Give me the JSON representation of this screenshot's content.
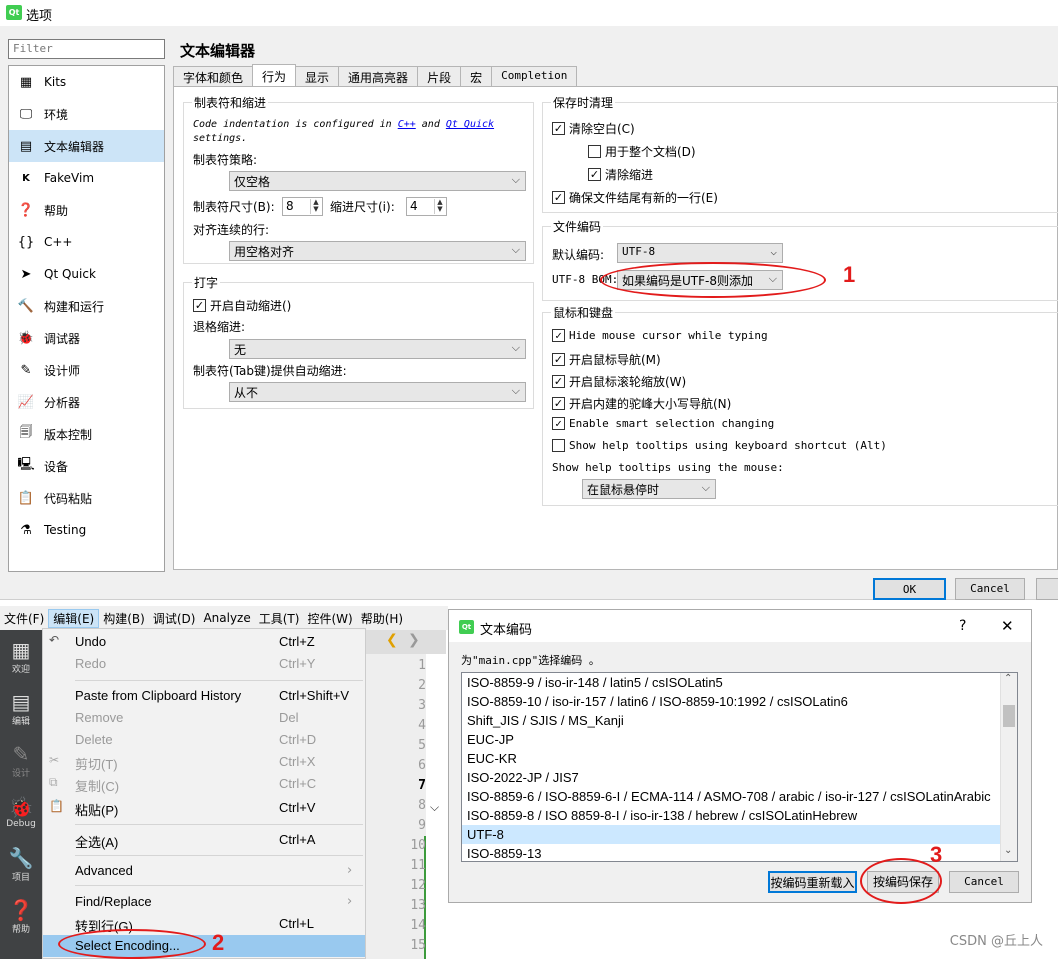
{
  "top": {
    "title": "选项",
    "filter_placeholder": "Filter",
    "sidebar": [
      "Kits",
      "环境",
      "文本编辑器",
      "FakeVim",
      "帮助",
      "C++",
      "Qt Quick",
      "构建和运行",
      "调试器",
      "设计师",
      "分析器",
      "版本控制",
      "设备",
      "代码粘贴",
      "Testing"
    ],
    "page_title": "文本编辑器",
    "tabs": [
      "字体和颜色",
      "行为",
      "显示",
      "通用高亮器",
      "片段",
      "宏",
      "Completion"
    ],
    "tabs_indent": {
      "title": "制表符和缩进",
      "note_a": "Code indentation is configured in ",
      "link_cpp": "C++",
      "note_and": " and ",
      "link_qtquick": "Qt Quick",
      "note_b": "settings.",
      "policy_label": "制表符策略:",
      "policy_value": "仅空格",
      "tab_size_label": "制表符尺寸(B):",
      "tab_size": "8",
      "indent_size_label": "缩进尺寸(i):",
      "indent_size": "4",
      "align_label": "对齐连续的行:",
      "align_value": "用空格对齐"
    },
    "typing": {
      "title": "打字",
      "auto_indent": "开启自动缩进()",
      "backspace_label": "退格缩进:",
      "backspace_value": "无",
      "tab_key_label": "制表符(Tab键)提供自动缩进:",
      "tab_key_value": "从不"
    },
    "cleanup": {
      "title": "保存时清理",
      "clean_whitespace": "清除空白(C)",
      "entire_doc": "用于整个文档(D)",
      "clean_indent": "清除缩进",
      "ensure_newline": "确保文件结尾有新的一行(E)"
    },
    "encoding": {
      "title": "文件编码",
      "default_label": "默认编码:",
      "default_value": "UTF-8",
      "bom_label": "UTF-8 BOM:",
      "bom_value": "如果编码是UTF-8则添加"
    },
    "mouse": {
      "title": "鼠标和键盘",
      "items": [
        "Hide mouse cursor while typing",
        "开启鼠标导航(M)",
        "开启鼠标滚轮缩放(W)",
        "开启内建的驼峰大小写导航(N)",
        "Enable smart selection changing",
        "Show help tooltips using keyboard shortcut (Alt)"
      ],
      "checked": [
        true,
        true,
        true,
        true,
        true,
        false
      ],
      "tooltip_label": "Show help tooltips using the mouse:",
      "tooltip_value": "在鼠标悬停时"
    },
    "ok": "OK",
    "cancel": "Cancel"
  },
  "annotations": [
    "1",
    "2",
    "3"
  ],
  "menubar": [
    "文件(F)",
    "编辑(E)",
    "构建(B)",
    "调试(D)",
    "Analyze",
    "工具(T)",
    "控件(W)",
    "帮助(H)"
  ],
  "leftbar": [
    "欢迎",
    "编辑",
    "设计",
    "Debug",
    "项目",
    "帮助"
  ],
  "edit_menu": [
    {
      "label": "Undo",
      "shortcut": "Ctrl+Z",
      "disabled": false
    },
    {
      "label": "Redo",
      "shortcut": "Ctrl+Y",
      "disabled": true
    },
    {
      "label": "Paste from Clipboard History",
      "shortcut": "Ctrl+Shift+V",
      "disabled": false
    },
    {
      "label": "Remove",
      "shortcut": "Del",
      "disabled": true
    },
    {
      "label": "Delete",
      "shortcut": "Ctrl+D",
      "disabled": true
    },
    {
      "label": "剪切(T)",
      "shortcut": "Ctrl+X",
      "disabled": true
    },
    {
      "label": "复制(C)",
      "shortcut": "Ctrl+C",
      "disabled": true
    },
    {
      "label": "粘贴(P)",
      "shortcut": "Ctrl+V",
      "disabled": false
    },
    {
      "label": "全选(A)",
      "shortcut": "Ctrl+A",
      "disabled": false
    },
    {
      "label": "Advanced",
      "shortcut": "",
      "disabled": false
    },
    {
      "label": "Find/Replace",
      "shortcut": "",
      "disabled": false
    },
    {
      "label": "转到行(G)...",
      "shortcut": "Ctrl+L",
      "disabled": false
    },
    {
      "label": "Select Encoding...",
      "shortcut": "",
      "disabled": false
    }
  ],
  "gutter": [
    "1",
    "2",
    "3",
    "4",
    "5",
    "6",
    "7",
    "8",
    "9",
    "10",
    "11",
    "12",
    "13",
    "14",
    "15"
  ],
  "enc_dialog": {
    "title": "文本编码",
    "help": "?",
    "close": "✕",
    "prompt": "为\"main.cpp\"选择编码 。",
    "items": [
      "ISO-8859-9 / iso-ir-148 / latin5 / csISOLatin5",
      "ISO-8859-10 / iso-ir-157 / latin6 / ISO-8859-10:1992 / csISOLatin6",
      "Shift_JIS / SJIS / MS_Kanji",
      "EUC-JP",
      "EUC-KR",
      "ISO-2022-JP / JIS7",
      "ISO-8859-6 / ISO-8859-6-I / ECMA-114 / ASMO-708 / arabic / iso-ir-127 / csISOLatinArabic",
      "ISO-8859-8 / ISO 8859-8-I / iso-ir-138 / hebrew / csISOLatinHebrew",
      "UTF-8",
      "ISO-8859-13"
    ],
    "selected": "UTF-8",
    "reload": "按编码重新载入",
    "save": "按编码保存",
    "cancel": "Cancel"
  },
  "watermark": "CSDN @丘上人"
}
